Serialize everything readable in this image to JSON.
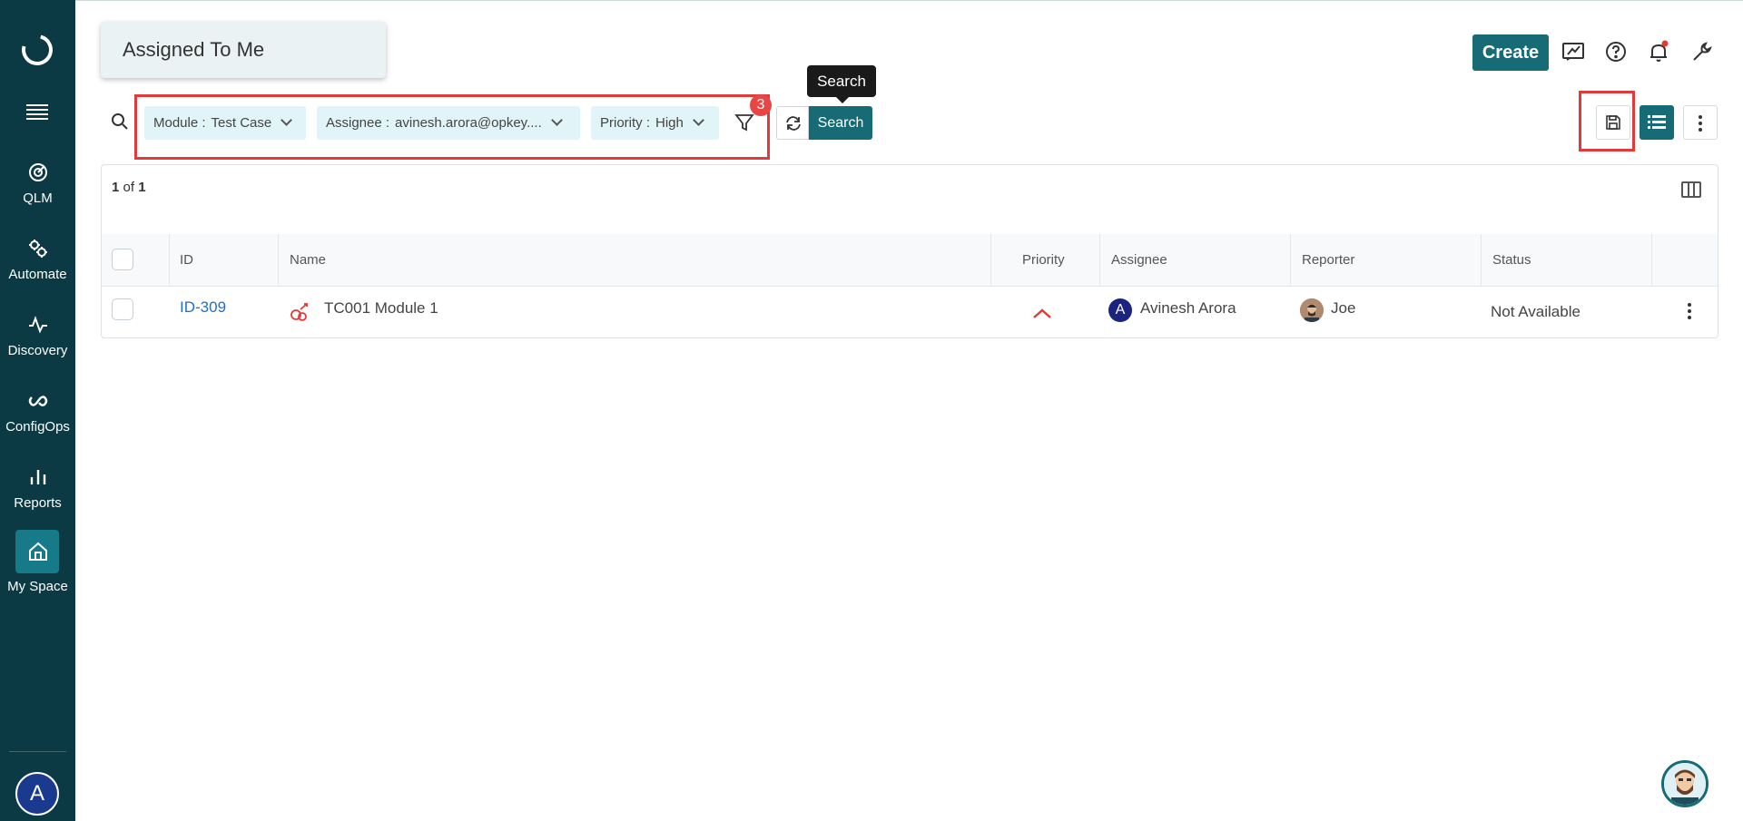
{
  "sidebar": {
    "items": [
      {
        "label": "QLM",
        "icon": "target-icon"
      },
      {
        "label": "Automate",
        "icon": "gears-icon"
      },
      {
        "label": "Discovery",
        "icon": "pulse-icon"
      },
      {
        "label": "ConfigOps",
        "icon": "infinity-icon"
      },
      {
        "label": "Reports",
        "icon": "bar-chart-icon"
      },
      {
        "label": "My Space",
        "icon": "home-icon",
        "active": true
      }
    ],
    "user_initial": "A"
  },
  "header": {
    "title": "Assigned To Me",
    "create_label": "Create"
  },
  "filters": {
    "chips": [
      {
        "key": "Module :",
        "value": "Test Case"
      },
      {
        "key": "Assignee :",
        "value": "avinesh.arora@opkey...."
      },
      {
        "key": "Priority :",
        "value": "High"
      }
    ],
    "count_badge": "3",
    "search_label": "Search",
    "tooltip": "Search"
  },
  "table": {
    "pagination": {
      "current": "1",
      "of": "of",
      "total": "1"
    },
    "columns": [
      "ID",
      "Name",
      "Priority",
      "Assignee",
      "Reporter",
      "Status"
    ],
    "rows": [
      {
        "id_prefix": "ID-",
        "id_number": "309",
        "name": "TC001 Module 1",
        "priority": "High",
        "assignee_initial": "A",
        "assignee": "Avinesh Arora",
        "reporter": "Joe",
        "status": "Not Available"
      }
    ]
  },
  "colors": {
    "sidebar_bg": "#0b3a44",
    "accent": "#166b77",
    "highlight_red": "#e03a3a",
    "chip_bg": "#e1f4f7",
    "link_blue": "#1a73c9",
    "notification_dot": "#e53935"
  }
}
